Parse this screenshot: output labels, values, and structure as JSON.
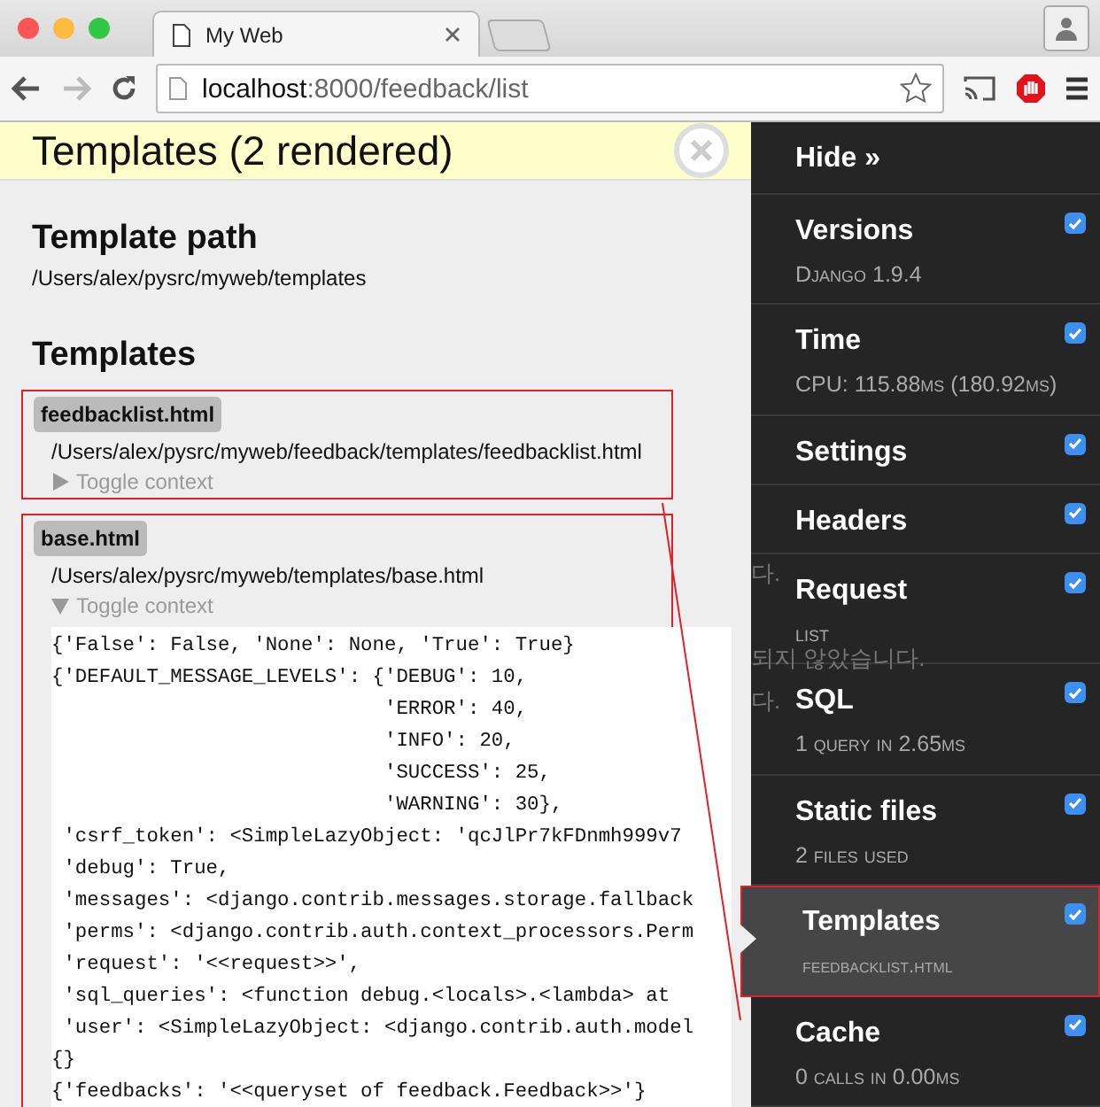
{
  "browser": {
    "tab_title": "My Web",
    "url_host": "localhost",
    "url_rest": ":8000/feedback/list",
    "forward_disabled": true
  },
  "panel": {
    "title": "Templates (2 rendered)",
    "path_heading": "Template path",
    "path": "/Users/alex/pysrc/myweb/templates",
    "templates_heading": "Templates",
    "templates": [
      {
        "name": "feedbacklist.html",
        "path": "/Users/alex/pysrc/myweb/feedback/templates/feedbacklist.html",
        "toggle": "Toggle context",
        "expanded": false,
        "annotated": true
      },
      {
        "name": "base.html",
        "path": "/Users/alex/pysrc/myweb/templates/base.html",
        "toggle": "Toggle context",
        "expanded": true,
        "annotated": true,
        "context_lines": [
          "{'False': False, 'None': None, 'True': True}",
          "{'DEFAULT_MESSAGE_LEVELS': {'DEBUG': 10,",
          "                            'ERROR': 40,",
          "                            'INFO': 20,",
          "                            'SUCCESS': 25,",
          "                            'WARNING': 30},",
          " 'csrf_token': <SimpleLazyObject: 'qcJlPr7kFDnmh999v7",
          " 'debug': True,",
          " 'messages': <django.contrib.messages.storage.fallback",
          " 'perms': <django.contrib.auth.context_processors.Perm",
          " 'request': '<<request>>',",
          " 'sql_queries': <function debug.<locals>.<lambda> at",
          " 'user': <SimpleLazyObject: <django.contrib.auth.model",
          "{}",
          "{'feedbacks': '<<queryset of feedback.Feedback>>'}"
        ]
      }
    ]
  },
  "sidebar": {
    "hide_label": "Hide »",
    "ghost_text": [
      "다.",
      "되지 않았습니다.",
      "다."
    ],
    "items": [
      {
        "title": "Versions",
        "subtitle": "Django 1.9.4",
        "checked": true,
        "selected": false,
        "annotated": false
      },
      {
        "title": "Time",
        "subtitle": "CPU: 115.88ms (180.92ms)",
        "checked": true,
        "selected": false,
        "annotated": false
      },
      {
        "title": "Settings",
        "checked": true,
        "selected": false,
        "annotated": false
      },
      {
        "title": "Headers",
        "checked": true,
        "selected": false,
        "annotated": false
      },
      {
        "title": "Request",
        "subtitle": "list",
        "checked": true,
        "selected": false,
        "annotated": false
      },
      {
        "title": "SQL",
        "subtitle": "1 query in 2.65ms",
        "checked": true,
        "selected": false,
        "annotated": false
      },
      {
        "title": "Static files",
        "subtitle": "2 files used",
        "checked": true,
        "selected": false,
        "annotated": false
      },
      {
        "title": "Templates",
        "subtitle": "feedbacklist.html",
        "checked": true,
        "selected": true,
        "annotated": true
      },
      {
        "title": "Cache",
        "subtitle": "0 calls in 0.00ms",
        "checked": true,
        "selected": false,
        "annotated": false
      }
    ]
  }
}
